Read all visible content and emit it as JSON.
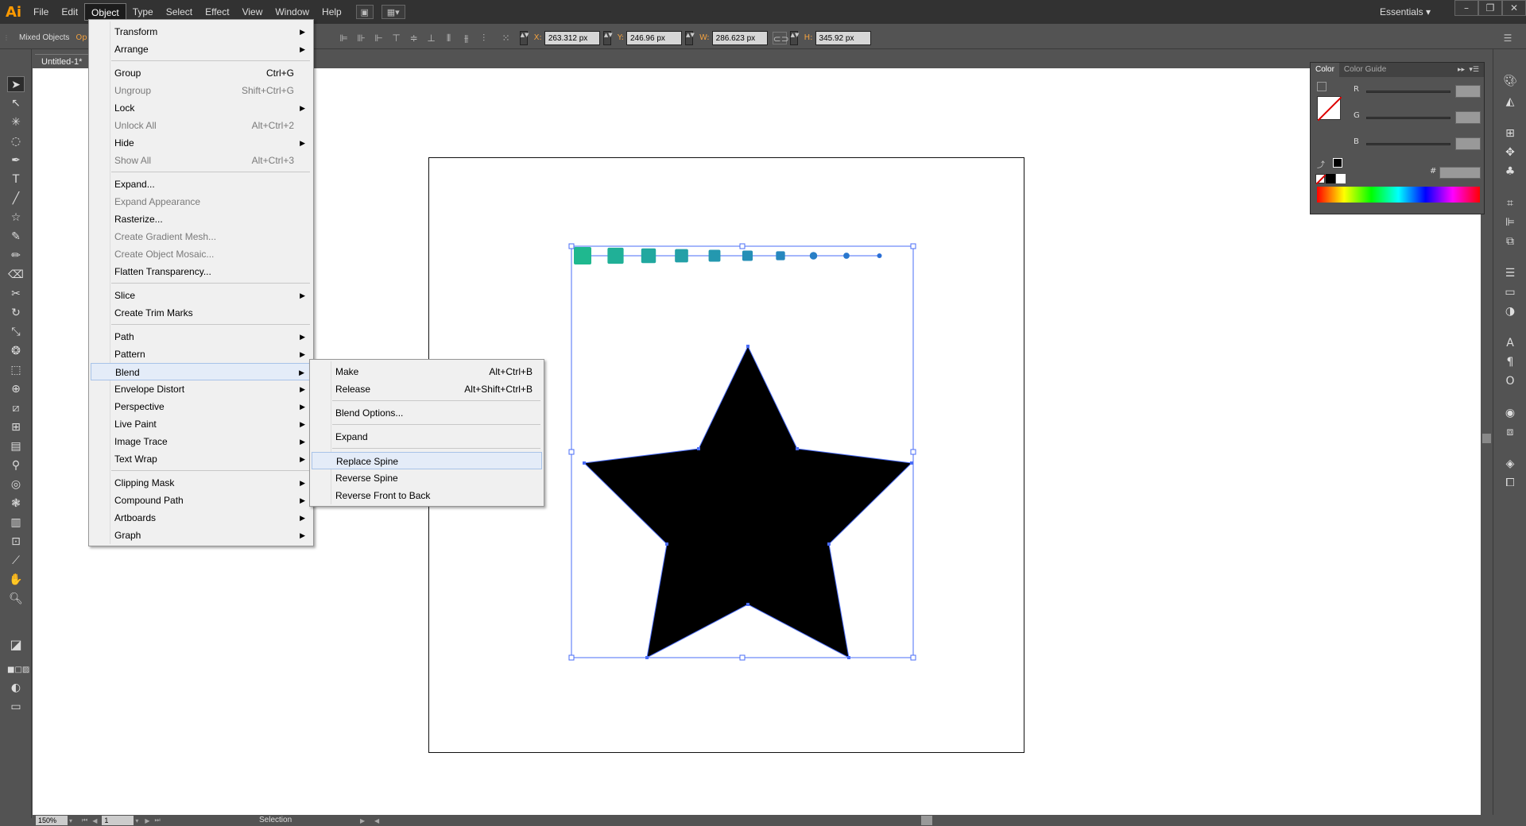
{
  "app": {
    "logo": "Ai",
    "workspace": "Essentials ▾"
  },
  "menubar": [
    "File",
    "Edit",
    "Object",
    "Type",
    "Select",
    "Effect",
    "View",
    "Window",
    "Help"
  ],
  "control": {
    "selection": "Mixed Objects",
    "opacity_label": "Op",
    "x_label": "X:",
    "x": "263.312 px",
    "y_label": "Y:",
    "y": "246.96 px",
    "w_label": "W:",
    "w": "286.623 px",
    "h_label": "H:",
    "h": "345.92 px"
  },
  "document": {
    "tab": "Untitled-1*"
  },
  "object_menu": {
    "items": [
      {
        "label": "Transform",
        "shortcut": "",
        "submenu": true,
        "disabled": false
      },
      {
        "label": "Arrange",
        "shortcut": "",
        "submenu": true,
        "disabled": false
      },
      {
        "label": "Group",
        "shortcut": "Ctrl+G",
        "submenu": false,
        "disabled": false
      },
      {
        "label": "Ungroup",
        "shortcut": "Shift+Ctrl+G",
        "submenu": false,
        "disabled": true
      },
      {
        "label": "Lock",
        "shortcut": "",
        "submenu": true,
        "disabled": false
      },
      {
        "label": "Unlock All",
        "shortcut": "Alt+Ctrl+2",
        "submenu": false,
        "disabled": true
      },
      {
        "label": "Hide",
        "shortcut": "",
        "submenu": true,
        "disabled": false
      },
      {
        "label": "Show All",
        "shortcut": "Alt+Ctrl+3",
        "submenu": false,
        "disabled": true
      },
      {
        "label": "Expand...",
        "shortcut": "",
        "submenu": false,
        "disabled": false
      },
      {
        "label": "Expand Appearance",
        "shortcut": "",
        "submenu": false,
        "disabled": true
      },
      {
        "label": "Rasterize...",
        "shortcut": "",
        "submenu": false,
        "disabled": false
      },
      {
        "label": "Create Gradient Mesh...",
        "shortcut": "",
        "submenu": false,
        "disabled": true
      },
      {
        "label": "Create Object Mosaic...",
        "shortcut": "",
        "submenu": false,
        "disabled": true
      },
      {
        "label": "Flatten Transparency...",
        "shortcut": "",
        "submenu": false,
        "disabled": false
      },
      {
        "label": "Slice",
        "shortcut": "",
        "submenu": true,
        "disabled": false
      },
      {
        "label": "Create Trim Marks",
        "shortcut": "",
        "submenu": false,
        "disabled": false
      },
      {
        "label": "Path",
        "shortcut": "",
        "submenu": true,
        "disabled": false
      },
      {
        "label": "Pattern",
        "shortcut": "",
        "submenu": true,
        "disabled": false
      },
      {
        "label": "Blend",
        "shortcut": "",
        "submenu": true,
        "disabled": false
      },
      {
        "label": "Envelope Distort",
        "shortcut": "",
        "submenu": true,
        "disabled": false
      },
      {
        "label": "Perspective",
        "shortcut": "",
        "submenu": true,
        "disabled": false
      },
      {
        "label": "Live Paint",
        "shortcut": "",
        "submenu": true,
        "disabled": false
      },
      {
        "label": "Image Trace",
        "shortcut": "",
        "submenu": true,
        "disabled": false
      },
      {
        "label": "Text Wrap",
        "shortcut": "",
        "submenu": true,
        "disabled": false
      },
      {
        "label": "Clipping Mask",
        "shortcut": "",
        "submenu": true,
        "disabled": false
      },
      {
        "label": "Compound Path",
        "shortcut": "",
        "submenu": true,
        "disabled": false
      },
      {
        "label": "Artboards",
        "shortcut": "",
        "submenu": true,
        "disabled": false
      },
      {
        "label": "Graph",
        "shortcut": "",
        "submenu": true,
        "disabled": false
      }
    ]
  },
  "blend_menu": {
    "items": [
      {
        "label": "Make",
        "shortcut": "Alt+Ctrl+B"
      },
      {
        "label": "Release",
        "shortcut": "Alt+Shift+Ctrl+B"
      },
      {
        "label": "Blend Options...",
        "shortcut": ""
      },
      {
        "label": "Expand",
        "shortcut": ""
      },
      {
        "label": "Replace Spine",
        "shortcut": ""
      },
      {
        "label": "Reverse Spine",
        "shortcut": ""
      },
      {
        "label": "Reverse Front to Back",
        "shortcut": ""
      }
    ]
  },
  "color_panel": {
    "tabs": [
      "Color",
      "Color Guide"
    ],
    "channels": [
      "R",
      "G",
      "B"
    ],
    "hex_label": "#"
  },
  "status": {
    "zoom": "150%",
    "artboard": "1",
    "tool": "Selection"
  },
  "colors": {
    "accent": "#ff9a00",
    "selection": "#4a6cf7",
    "blend_start": "#1fb88f",
    "blend_end": "#2a6fd6"
  }
}
